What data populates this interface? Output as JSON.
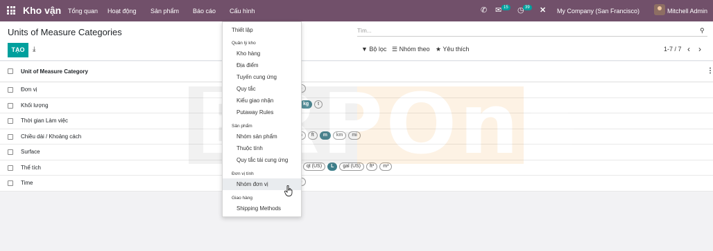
{
  "topbar": {
    "brand": "Kho vận",
    "menu": [
      "Tổng quan",
      "Hoạt động",
      "Sản phẩm",
      "Báo cáo",
      "Cấu hình"
    ],
    "messages_badge": "15",
    "activity_badge": "39",
    "company": "My Company (San Francisco)",
    "user": "Mitchell Admin"
  },
  "control": {
    "title": "Units of Measure Categories",
    "create_label": "TẠO",
    "search_placeholder": "Tìm...",
    "filter_label": "Bộ lọc",
    "groupby_label": "Nhóm theo",
    "favorites_label": "Yêu thích",
    "pager": "1-7 / 7"
  },
  "list": {
    "header": "Unit of Measure Category",
    "rows": [
      {
        "name": "Đơn vị",
        "tags": [
          "s"
        ]
      },
      {
        "name": "Khối lượng",
        "tags": [
          "kg",
          "t"
        ]
      },
      {
        "name": "Thời gian Làm việc",
        "tags": []
      },
      {
        "name": "Chiều dài / Khoảng cách",
        "tags": [
          "n",
          "ft",
          "m",
          "km",
          "mi"
        ]
      },
      {
        "name": "Surface",
        "tags": []
      },
      {
        "name": "Thể tích",
        "tags": [
          "l)",
          "qt (US)",
          "L",
          "gal (US)",
          "ft³",
          "m³"
        ]
      },
      {
        "name": "Time",
        "tags": [
          "s"
        ]
      }
    ]
  },
  "dropdown": {
    "top_item": "Thiết lập",
    "sections": [
      {
        "title": "Quản lý kho",
        "items": [
          "Kho hàng",
          "Địa điểm",
          "Tuyến cung ứng",
          "Quy tắc",
          "Kiểu giao nhận",
          "Putaway Rules"
        ]
      },
      {
        "title": "Sản phẩm",
        "items": [
          "Nhóm sản phẩm",
          "Thuộc tính",
          "Quy tắc tái cung ứng"
        ]
      },
      {
        "title": "Đơn vị tính",
        "items": [
          "Nhóm đơn vị"
        ]
      },
      {
        "title": "Giao hàng",
        "items": [
          "Shipping Methods"
        ]
      }
    ]
  },
  "watermark": {
    "text_left": "ERP",
    "text_right": "One"
  },
  "colors": {
    "topbar": "#71506a",
    "primary": "#00a09d",
    "tag_selected": "#3d7e8a"
  }
}
